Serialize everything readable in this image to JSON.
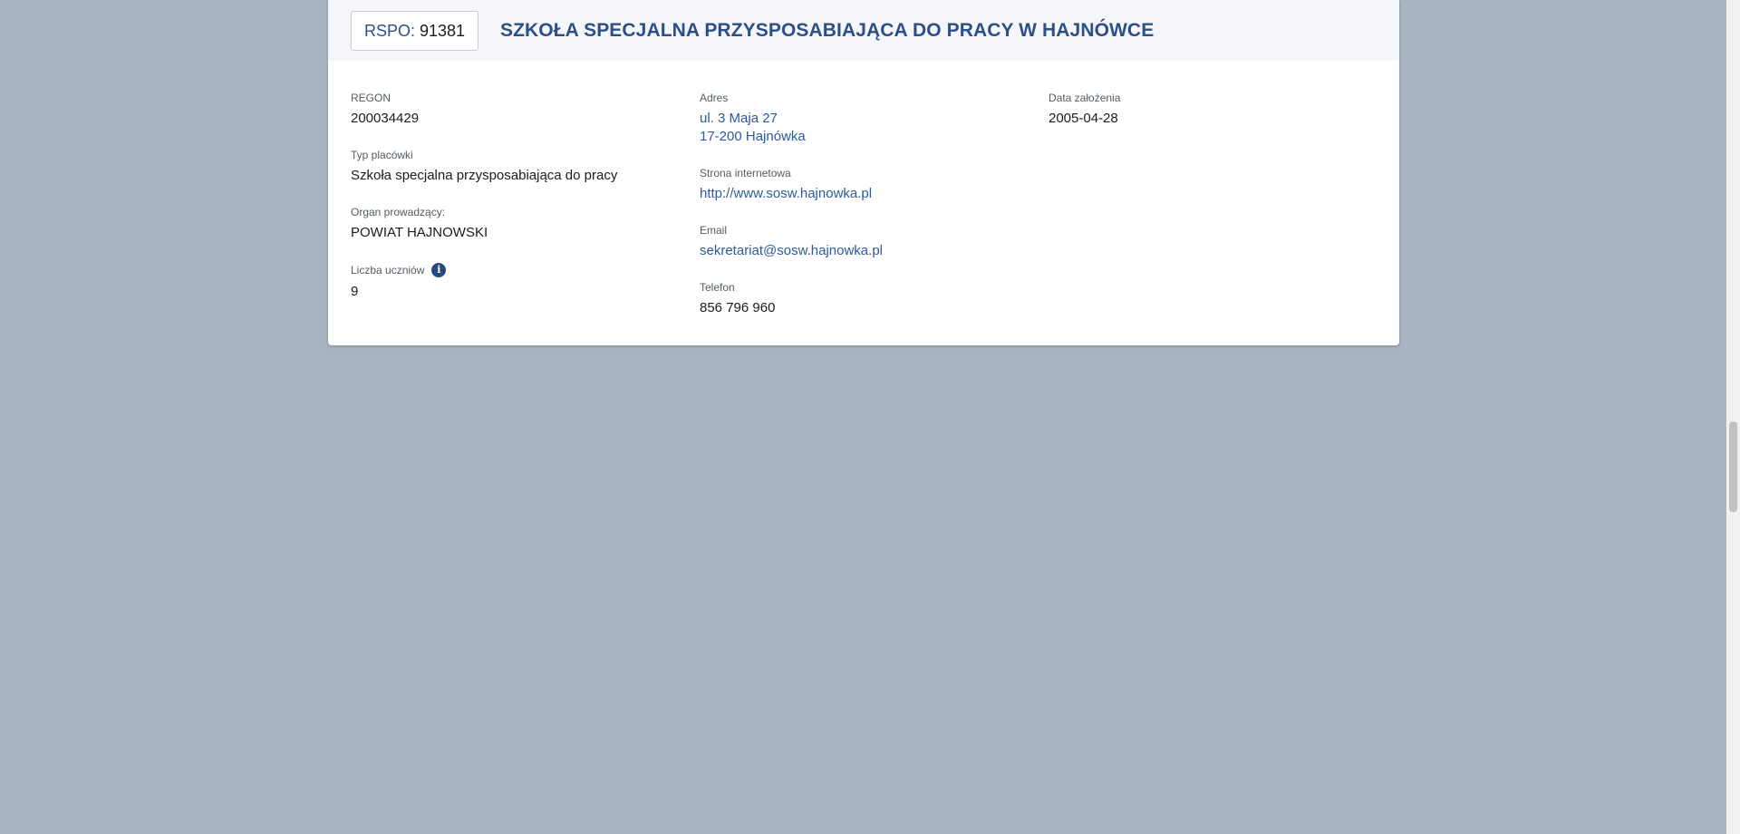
{
  "header": {
    "rspo_label": "RSPO:",
    "rspo_number": "91381",
    "school_name": "SZKOŁA SPECJALNA PRZYSPOSABIAJĄCA DO PRACY W HAJNÓWCE"
  },
  "details": {
    "regon": {
      "label": "REGON",
      "value": "200034429"
    },
    "type": {
      "label": "Typ placówki",
      "value": "Szkoła specjalna przysposabiająca do pracy"
    },
    "organ": {
      "label": "Organ prowadzący:",
      "value": "POWIAT HAJNOWSKI"
    },
    "students": {
      "label": "Liczba uczniów",
      "value": "9",
      "info_icon": "info-icon"
    },
    "address": {
      "label": "Adres",
      "line1": "ul. 3 Maja 27",
      "line2": "17-200 Hajnówka"
    },
    "website": {
      "label": "Strona internetowa",
      "value": "http://www.sosw.hajnowka.pl"
    },
    "email": {
      "label": "Email",
      "value": "sekretariat@sosw.hajnowka.pl"
    },
    "phone": {
      "label": "Telefon",
      "value": "856 796 960"
    },
    "founded": {
      "label": "Data założenia",
      "value": "2005-04-28"
    }
  },
  "colors": {
    "page_background": "#a9b4c2",
    "accent": "#2d4f86",
    "link": "#2d5a9c"
  }
}
